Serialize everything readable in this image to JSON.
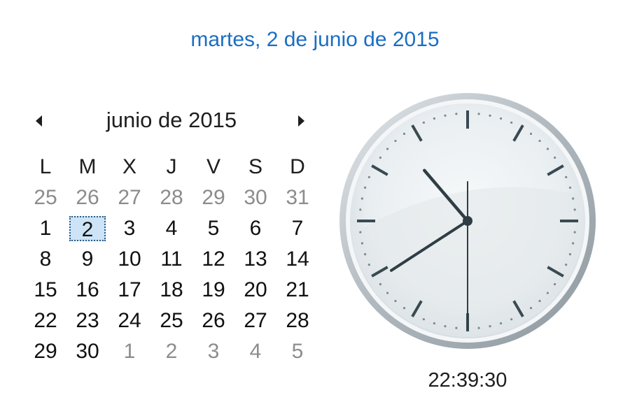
{
  "header": {
    "full_date": "martes, 2 de junio de 2015"
  },
  "calendar": {
    "month_label": "junio de 2015",
    "prev_icon": "triangle-left-icon",
    "next_icon": "triangle-right-icon",
    "weekdays": [
      "L",
      "M",
      "X",
      "J",
      "V",
      "S",
      "D"
    ],
    "weeks": [
      [
        {
          "d": "25",
          "o": true
        },
        {
          "d": "26",
          "o": true
        },
        {
          "d": "27",
          "o": true
        },
        {
          "d": "28",
          "o": true
        },
        {
          "d": "29",
          "o": true
        },
        {
          "d": "30",
          "o": true
        },
        {
          "d": "31",
          "o": true
        }
      ],
      [
        {
          "d": "1"
        },
        {
          "d": "2",
          "t": true
        },
        {
          "d": "3"
        },
        {
          "d": "4"
        },
        {
          "d": "5"
        },
        {
          "d": "6"
        },
        {
          "d": "7"
        }
      ],
      [
        {
          "d": "8"
        },
        {
          "d": "9"
        },
        {
          "d": "10"
        },
        {
          "d": "11"
        },
        {
          "d": "12"
        },
        {
          "d": "13"
        },
        {
          "d": "14"
        }
      ],
      [
        {
          "d": "15"
        },
        {
          "d": "16"
        },
        {
          "d": "17"
        },
        {
          "d": "18"
        },
        {
          "d": "19"
        },
        {
          "d": "20"
        },
        {
          "d": "21"
        }
      ],
      [
        {
          "d": "22"
        },
        {
          "d": "23"
        },
        {
          "d": "24"
        },
        {
          "d": "25"
        },
        {
          "d": "26"
        },
        {
          "d": "27"
        },
        {
          "d": "28"
        }
      ],
      [
        {
          "d": "29"
        },
        {
          "d": "30"
        },
        {
          "d": "1",
          "o": true
        },
        {
          "d": "2",
          "o": true
        },
        {
          "d": "3",
          "o": true
        },
        {
          "d": "4",
          "o": true
        },
        {
          "d": "5",
          "o": true
        }
      ]
    ],
    "colors": {
      "header_text": "#1b6ec2",
      "other_month_text": "#8c8c8c",
      "today_bg": "#cde4f7",
      "today_border": "#2b5b85"
    }
  },
  "clock": {
    "time_text": "22:39:30",
    "hours": 22,
    "minutes": 39,
    "seconds": 30
  }
}
